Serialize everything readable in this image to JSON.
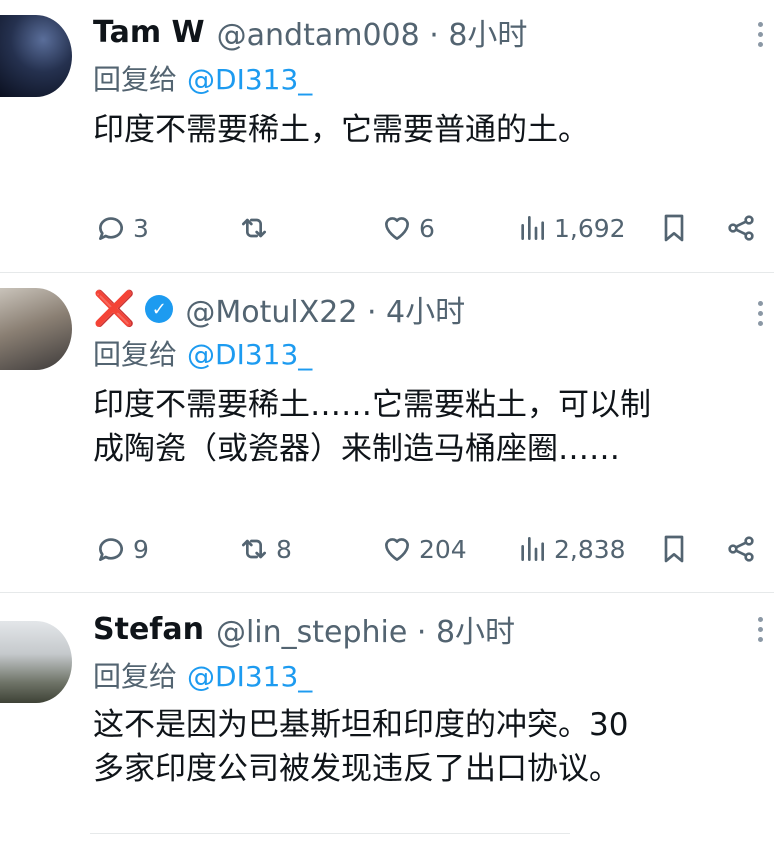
{
  "tweets": [
    {
      "name": "Tam W",
      "handle": "@andtam008 · 8小时",
      "reply_prefix": "回复给",
      "reply_to": "@DI313_",
      "text_lines": [
        "印度不需要稀土，它需要普通的土。"
      ],
      "replies": "3",
      "retweets": "",
      "likes": "6",
      "views": "1,692"
    },
    {
      "name_icon": "❌",
      "verified_icon": "✓",
      "handle": "@MotulX22 · 4小时",
      "reply_prefix": "回复给",
      "reply_to": "@DI313_",
      "text_lines": [
        "印度不需要稀土……它需要粘土，可以制",
        "成陶瓷（或瓷器）来制造马桶座圈……"
      ],
      "replies": "9",
      "retweets": "8",
      "likes": "204",
      "views": "2,838"
    },
    {
      "name": "Stefan",
      "handle": "@lin_stephie · 8小时",
      "reply_prefix": "回复给",
      "reply_to": "@DI313_",
      "text_lines": [
        "这不是因为巴基斯坦和印度的冲突。30",
        "多家印度公司被发现违反了出口协议。"
      ]
    }
  ],
  "colors": {
    "text": "#0f1419",
    "muted": "#536471",
    "link": "#1d9bf0",
    "red_x": "#e0262d"
  },
  "icons": [
    "reply-icon",
    "retweet-icon",
    "like-icon",
    "views-icon",
    "bookmark-icon",
    "share-icon",
    "more-icon",
    "verified-badge-icon"
  ]
}
